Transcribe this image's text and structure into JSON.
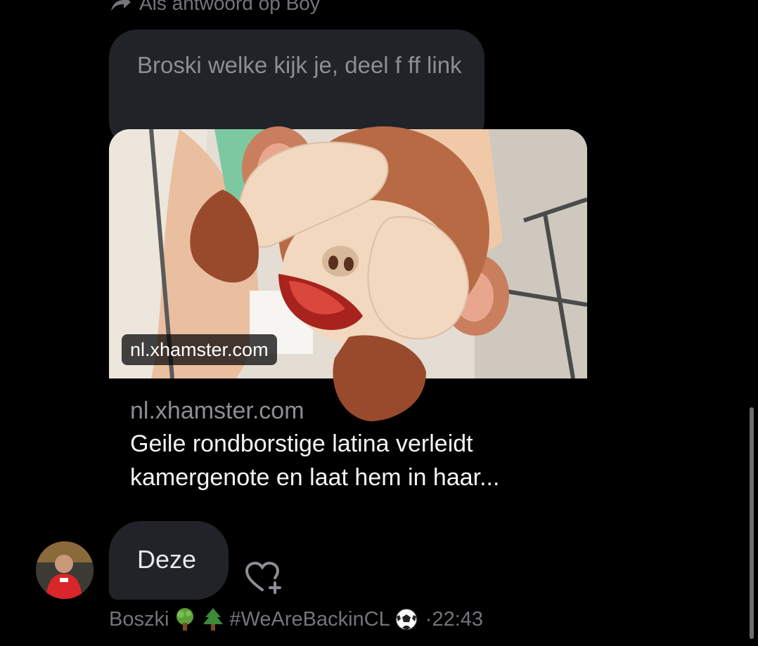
{
  "reply_context": {
    "text": "Als antwoord op Boy"
  },
  "quoted_message": {
    "text": "Broski welke kijk je, deel f ff link"
  },
  "link_card": {
    "overlay_domain": "nl.xhamster.com",
    "domain": "nl.xhamster.com",
    "title_line1": "Geile rondborstige latina verleidt",
    "title_line2": "kamergenote en laat hem in haar..."
  },
  "message": {
    "text": "Deze"
  },
  "meta": {
    "sender": "Boszki",
    "hashtag": "#WeAreBackinCL",
    "time": "·22:43"
  },
  "icons": {
    "reply": "reply-arrow-icon",
    "react": "add-reaction-heart-icon",
    "tree": "tree-emoji-icon",
    "evergreen": "evergreen-tree-emoji-icon",
    "soccer": "soccer-ball-emoji-icon",
    "monkey": "see-no-evil-monkey-sticker"
  },
  "colors": {
    "background": "#000000",
    "bubble": "#202327",
    "muted_text": "#71767b",
    "primary_text": "#e7e9ea"
  }
}
